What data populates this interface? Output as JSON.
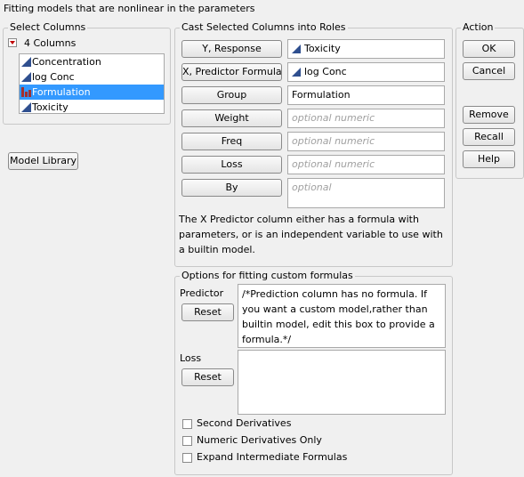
{
  "title": "Fitting models that are nonlinear in the parameters",
  "select_columns": {
    "legend": "Select Columns",
    "count_label": "4 Columns",
    "items": [
      {
        "label": "Concentration",
        "type": "continuous",
        "selected": false
      },
      {
        "label": "log Conc",
        "type": "continuous",
        "selected": false
      },
      {
        "label": "Formulation",
        "type": "nominal",
        "selected": true
      },
      {
        "label": "Toxicity",
        "type": "continuous",
        "selected": false
      }
    ]
  },
  "model_library_label": "Model Library",
  "cast": {
    "legend": "Cast Selected Columns into Roles",
    "roles": [
      {
        "button": "Y, Response",
        "value": "Toxicity",
        "placeholder": ""
      },
      {
        "button": "X, Predictor Formula",
        "value": "log Conc",
        "placeholder": ""
      },
      {
        "button": "Group",
        "value": "Formulation",
        "placeholder": ""
      },
      {
        "button": "Weight",
        "value": "",
        "placeholder": "optional numeric"
      },
      {
        "button": "Freq",
        "value": "",
        "placeholder": "optional numeric"
      },
      {
        "button": "Loss",
        "value": "",
        "placeholder": "optional numeric"
      },
      {
        "button": "By",
        "value": "",
        "placeholder": "optional"
      }
    ],
    "note": "The X Predictor column either has a formula with parameters, or is an independent variable to use with a builtin model."
  },
  "action": {
    "legend": "Action",
    "ok": "OK",
    "cancel": "Cancel",
    "remove": "Remove",
    "recall": "Recall",
    "help": "Help"
  },
  "options": {
    "legend": "Options for fitting custom formulas",
    "predictor_label": "Predictor",
    "predictor_reset": "Reset",
    "predictor_text": "/*Prediction column has no formula. If you want a custom model,rather than builtin model, edit this box to provide a formula.*/",
    "loss_label": "Loss",
    "loss_reset": "Reset",
    "loss_text": "",
    "checkboxes": [
      {
        "label": "Second Derivatives",
        "checked": false
      },
      {
        "label": "Numeric Derivatives Only",
        "checked": false
      },
      {
        "label": "Expand Intermediate Formulas",
        "checked": false
      }
    ]
  }
}
